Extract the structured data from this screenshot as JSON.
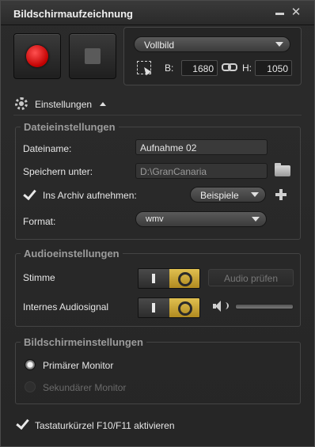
{
  "window": {
    "title": "Bildschirmaufzeichnung"
  },
  "capture": {
    "mode_selected": "Vollbild",
    "width_label": "B:",
    "width_value": "1680",
    "height_label": "H:",
    "height_value": "1050"
  },
  "settings": {
    "toggle_label": "Einstellungen"
  },
  "file_settings": {
    "legend": "Dateieinstellungen",
    "filename_label": "Dateiname:",
    "filename_value": "Aufnahme 02",
    "save_label": "Speichern unter:",
    "save_value": "D:\\GranCanaria",
    "archive_label": "Ins Archiv aufnehmen:",
    "archive_checked": true,
    "archive_option": "Beispiele",
    "format_label": "Format:",
    "format_value": "wmv"
  },
  "audio_settings": {
    "legend": "Audioeinstellungen",
    "voice_label": "Stimme",
    "voice_on": true,
    "test_audio_label": "Audio prüfen",
    "internal_label": "Internes Audiosignal",
    "internal_on": true
  },
  "screen_settings": {
    "legend": "Bildschirmeinstellungen",
    "primary_label": "Primärer Monitor",
    "secondary_label": "Sekundärer Monitor",
    "selected": "primary"
  },
  "shortcut": {
    "label": "Tastaturkürzel F10/F11 aktivieren",
    "checked": true
  },
  "colors": {
    "record": "#d00000",
    "toggle_on": "#d4b040",
    "background": "#262626"
  }
}
